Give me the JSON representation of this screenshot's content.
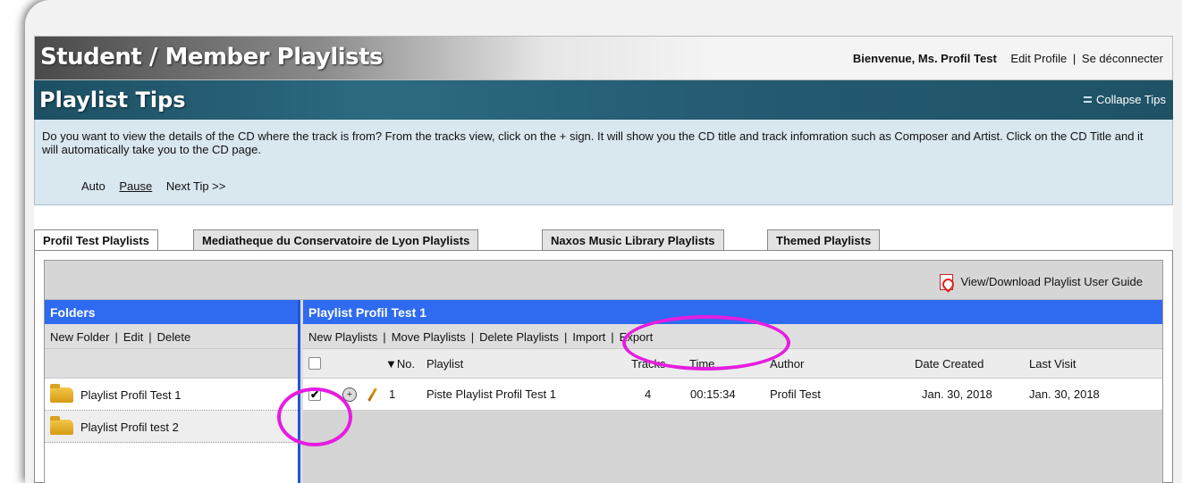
{
  "header": {
    "title": "Student / Member Playlists",
    "welcome": "Bienvenue, Ms. Profil Test",
    "edit_profile": "Edit Profile",
    "separator": "|",
    "logout": "Se déconnecter"
  },
  "tips": {
    "title": "Playlist Tips",
    "collapse_label": "Collapse Tips",
    "text": "Do you want to view the details of the CD where the track is from? From the tracks view, click on the + sign. It will show you the CD title and track infomration such as Composer and Artist. Click on the CD Title and it will automatically take you to the CD page.",
    "controls": {
      "auto": "Auto",
      "pause": "Pause",
      "next": "Next Tip >>"
    }
  },
  "tabs": [
    {
      "label": "Profil Test Playlists",
      "active": true
    },
    {
      "label": "Mediatheque du Conservatoire de Lyon Playlists",
      "active": false
    },
    {
      "label": "Naxos Music Library Playlists",
      "active": false
    },
    {
      "label": "Themed Playlists",
      "active": false
    }
  ],
  "guide": {
    "label": "View/Download Playlist User Guide"
  },
  "folders": {
    "header": "Folders",
    "actions": {
      "new": "New Folder",
      "edit": "Edit",
      "delete": "Delete",
      "sep": "|"
    },
    "items": [
      {
        "label": "Playlist Profil Test 1"
      },
      {
        "label": "Playlist Profil test 2"
      }
    ]
  },
  "playlists": {
    "header": "Playlist Profil Test 1",
    "actions": {
      "new": "New Playlists",
      "move": "Move Playlists",
      "delete": "Delete Playlists",
      "import": "Import",
      "export": "Export",
      "sep": "|"
    },
    "columns": {
      "no": "▼No.",
      "playlist": "Playlist",
      "tracks": "Tracks",
      "time": "Time",
      "author": "Author",
      "date_created": "Date Created",
      "last_visit": "Last Visit"
    },
    "rows": [
      {
        "checked": true,
        "no": "1",
        "playlist": "Piste Playlist Profil Test 1",
        "tracks": "4",
        "time": "00:15:34",
        "author": "Profil Test",
        "date_created": "Jan. 30, 2018",
        "last_visit": "Jan. 30, 2018"
      }
    ]
  },
  "colors": {
    "accent_blue": "#2f6bf0",
    "tips_teal": "#255c72",
    "highlight_magenta": "#e51de0"
  }
}
